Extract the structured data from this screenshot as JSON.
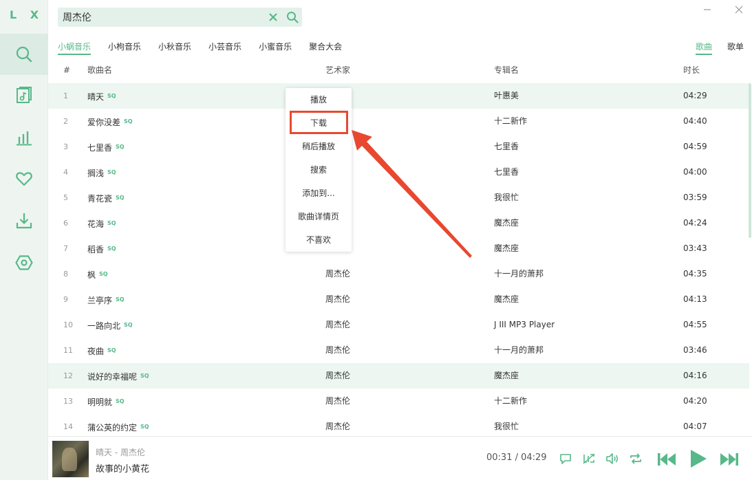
{
  "app": {
    "logo": "L X"
  },
  "search": {
    "value": "周杰伦",
    "placeholder": "搜索"
  },
  "source_tabs": [
    "小蜗音乐",
    "小枸音乐",
    "小秋音乐",
    "小芸音乐",
    "小蜜音乐",
    "聚合大会"
  ],
  "type_tabs": [
    "歌曲",
    "歌单"
  ],
  "table": {
    "headers": {
      "num": "#",
      "title": "歌曲名",
      "artist": "艺术家",
      "album": "专辑名",
      "duration": "时长"
    },
    "quality_badge": "SQ",
    "rows": [
      {
        "num": "1",
        "title": "晴天",
        "artist": "",
        "album": "叶惠美",
        "duration": "04:29"
      },
      {
        "num": "2",
        "title": "爱你没差",
        "artist": "",
        "album": "十二新作",
        "duration": "04:40"
      },
      {
        "num": "3",
        "title": "七里香",
        "artist": "",
        "album": "七里香",
        "duration": "04:59"
      },
      {
        "num": "4",
        "title": "搁浅",
        "artist": "",
        "album": "七里香",
        "duration": "04:00"
      },
      {
        "num": "5",
        "title": "青花瓷",
        "artist": "",
        "album": "我很忙",
        "duration": "03:59"
      },
      {
        "num": "6",
        "title": "花海",
        "artist": "",
        "album": "魔杰座",
        "duration": "04:24"
      },
      {
        "num": "7",
        "title": "稻香",
        "artist": "",
        "album": "魔杰座",
        "duration": "03:43"
      },
      {
        "num": "8",
        "title": "枫",
        "artist": "周杰伦",
        "album": "十一月的萧邦",
        "duration": "04:35"
      },
      {
        "num": "9",
        "title": "兰亭序",
        "artist": "周杰伦",
        "album": "魔杰座",
        "duration": "04:13"
      },
      {
        "num": "10",
        "title": "一路向北",
        "artist": "周杰伦",
        "album": "J III MP3 Player",
        "duration": "04:55"
      },
      {
        "num": "11",
        "title": "夜曲",
        "artist": "周杰伦",
        "album": "十一月的萧邦",
        "duration": "03:46"
      },
      {
        "num": "12",
        "title": "说好的幸福呢",
        "artist": "周杰伦",
        "album": "魔杰座",
        "duration": "04:16"
      },
      {
        "num": "13",
        "title": "明明就",
        "artist": "周杰伦",
        "album": "十二新作",
        "duration": "04:20"
      },
      {
        "num": "14",
        "title": "蒲公英的约定",
        "artist": "周杰伦",
        "album": "我很忙",
        "duration": "04:07"
      }
    ]
  },
  "context_menu": [
    "播放",
    "下载",
    "稍后播放",
    "搜索",
    "添加到...",
    "歌曲详情页",
    "不喜欢"
  ],
  "player": {
    "now_playing": "晴天 - 周杰伦",
    "lyric": "故事的小黄花",
    "time": "00:31 / 04:29"
  },
  "colors": {
    "accent": "#57b889",
    "highlight": "#e84830"
  }
}
